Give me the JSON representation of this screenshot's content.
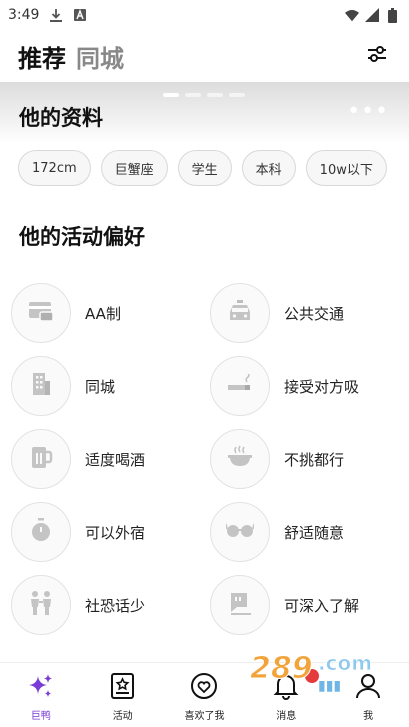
{
  "status_bar": {
    "time": "3:49"
  },
  "top_nav": {
    "tab_recommend": "推荐",
    "tab_local": "同城"
  },
  "profile": {
    "title": "他的资料",
    "more": "•••",
    "tags": [
      "172cm",
      "巨蟹座",
      "学生",
      "本科",
      "10w以下"
    ]
  },
  "preferences": {
    "title": "他的活动偏好",
    "items": [
      {
        "label": "AA制",
        "icon": "card-icon"
      },
      {
        "label": "公共交通",
        "icon": "taxi-icon"
      },
      {
        "label": "同城",
        "icon": "building-icon"
      },
      {
        "label": "接受对方吸",
        "icon": "cigarette-icon"
      },
      {
        "label": "适度喝酒",
        "icon": "beer-icon"
      },
      {
        "label": "不挑都行",
        "icon": "bowl-icon"
      },
      {
        "label": "可以外宿",
        "icon": "timer-icon"
      },
      {
        "label": "舒适随意",
        "icon": "glasses-icon"
      },
      {
        "label": "社恐话少",
        "icon": "people-icon"
      },
      {
        "label": "可深入了解",
        "icon": "chat-icon"
      }
    ]
  },
  "bottom_nav": {
    "items": [
      {
        "label": "巨鸭"
      },
      {
        "label": "活动"
      },
      {
        "label": "喜欢了我"
      },
      {
        "label": "消息"
      },
      {
        "label": "我"
      }
    ]
  },
  "colors": {
    "accent": "#7a3cd6",
    "badge": "#e43c3c",
    "icon_grey": "#bdbdbd"
  }
}
